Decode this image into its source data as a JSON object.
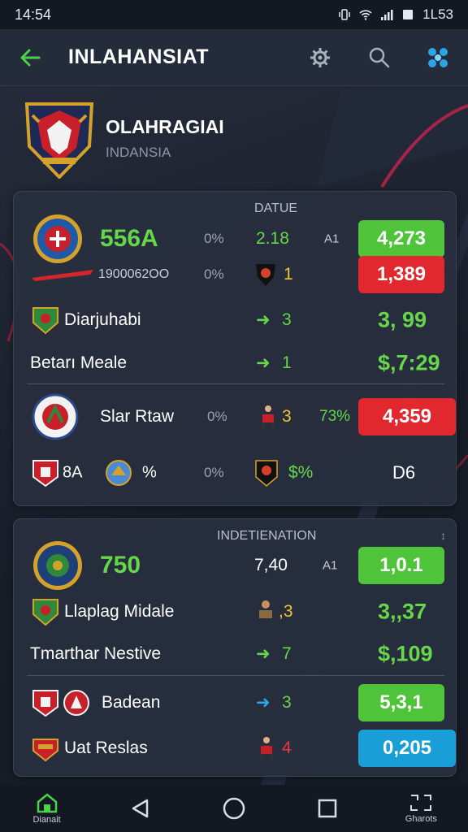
{
  "status": {
    "time": "14:54",
    "battery": "1L53"
  },
  "app_bar": {
    "title": "INLAHANSIAT"
  },
  "league": {
    "name": "OLAHRAGIAI",
    "sub": "INDANSIA"
  },
  "panel1": {
    "header": "DATUE",
    "rows": [
      {
        "score": "556A",
        "pct": "0%",
        "val": "2.18",
        "tag": "A1",
        "pill": "4,273"
      },
      {
        "name": "1900062OO",
        "pct": "0%",
        "num": "1",
        "pill": "1,389"
      },
      {
        "name": "Diarjuhabi",
        "num": "3",
        "value": "3, 99"
      },
      {
        "name": "Betarı Meale",
        "num": "1",
        "value": "$,7:29"
      },
      {
        "name": "Slar Rtaw",
        "pct": "0%",
        "num": "3",
        "pct2": "73%",
        "pill": "4,359"
      },
      {
        "name": "8A",
        "sym": "%",
        "pct": "0%",
        "text": "$%",
        "value": "D6"
      }
    ]
  },
  "panel2": {
    "header": "INDETIENATION",
    "corner": "↕",
    "rows": [
      {
        "score": "750",
        "val": "7,40",
        "tag": "A1",
        "pill": "1,0.1"
      },
      {
        "name": "Llaplag Midale",
        "num": ",3",
        "value": "3,,37"
      },
      {
        "name": "Tmarthar Nestive",
        "num": "7",
        "value": "$,109"
      },
      {
        "name": "Badean",
        "num": "3",
        "pill": "5,3,1"
      },
      {
        "name": "Uat Reslas",
        "num": "4",
        "pill": "0,205"
      }
    ]
  },
  "nav": {
    "home_label": "Dianait",
    "grid_label": "Gharots"
  },
  "colors": {
    "green": "#4fc43a",
    "red": "#e0282e",
    "blue": "#1a9ed8",
    "bg": "#1c2230"
  }
}
